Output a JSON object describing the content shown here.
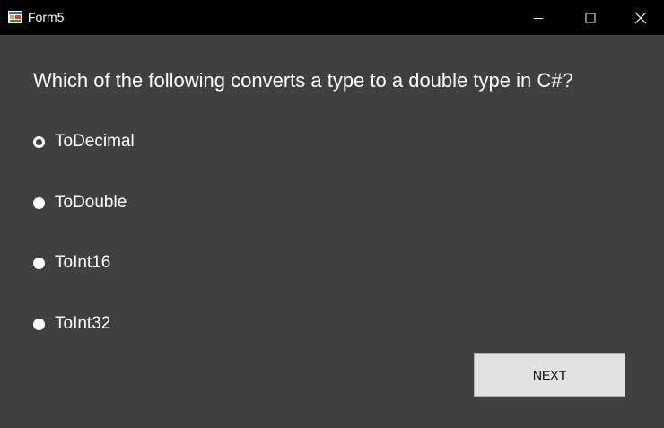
{
  "window": {
    "title": "Form5",
    "icon": "winforms-app-icon",
    "controls": {
      "minimize_icon": "minimize-icon",
      "maximize_icon": "maximize-icon",
      "close_icon": "close-icon"
    }
  },
  "quiz": {
    "question": "Which of the following converts a type to a double type in C#?",
    "options": [
      {
        "label": "ToDecimal",
        "selected": false
      },
      {
        "label": "ToDouble",
        "selected": false
      },
      {
        "label": "ToInt16",
        "selected": false
      },
      {
        "label": "ToInt32",
        "selected": false
      }
    ],
    "next_label": "NEXT"
  },
  "colors": {
    "titlebar_bg": "#000000",
    "client_bg": "#404040",
    "text": "#ffffff",
    "button_bg": "#e1e1e1"
  }
}
